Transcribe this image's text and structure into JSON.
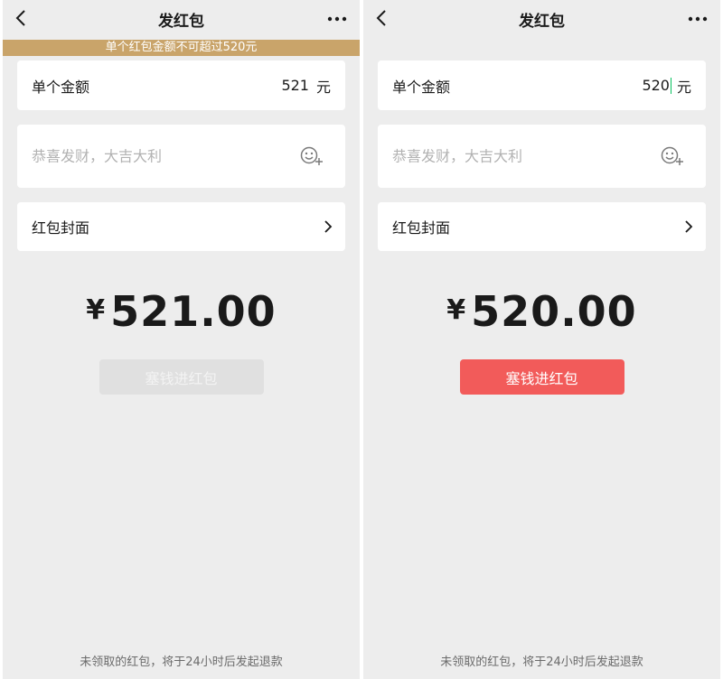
{
  "screens": [
    {
      "nav": {
        "title": "发红包",
        "back_icon": "chevron-left-icon",
        "more_icon": "more-dots-icon"
      },
      "warning": "单个红包金额不可超过520元",
      "amount": {
        "label": "单个金额",
        "value": "521",
        "unit": "元"
      },
      "greeting": {
        "placeholder": "恭喜发财，大吉大利",
        "emoji_icon": "emoji-add-icon"
      },
      "cover": {
        "label": "红包封面",
        "chevron_icon": "chevron-right-icon"
      },
      "total": {
        "currency": "¥",
        "amount": "521.00"
      },
      "send_button": {
        "label": "塞钱进红包",
        "state": "disabled",
        "color": "#e0e0e0"
      },
      "footer": "未领取的红包，将于24小时后发起退款"
    },
    {
      "nav": {
        "title": "发红包",
        "back_icon": "chevron-left-icon",
        "more_icon": "more-dots-icon"
      },
      "amount": {
        "label": "单个金额",
        "value": "520",
        "unit": "元"
      },
      "greeting": {
        "placeholder": "恭喜发财，大吉大利",
        "emoji_icon": "emoji-add-icon"
      },
      "cover": {
        "label": "红包封面",
        "chevron_icon": "chevron-right-icon"
      },
      "total": {
        "currency": "¥",
        "amount": "520.00"
      },
      "send_button": {
        "label": "塞钱进红包",
        "state": "enabled",
        "color": "#f25b5a"
      },
      "footer": "未领取的红包，将于24小时后发起退款"
    }
  ],
  "colors": {
    "warning_bar": "#c9a46a",
    "background": "#ededed",
    "caret": "#07c160"
  }
}
